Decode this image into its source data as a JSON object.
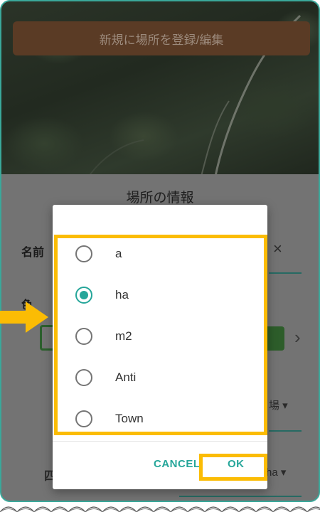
{
  "header": {
    "title": "新規に場所を登録/編集"
  },
  "sheet": {
    "title": "場所の情報",
    "name_label": "名前",
    "name_required_mark": "*",
    "clear_glyph": "×",
    "color_label": "色",
    "next_glyph": "›",
    "unit_value_1": "場 ▾",
    "unit_label_2": "四",
    "unit_value_2": "ha ▾"
  },
  "dialog": {
    "options": [
      {
        "label": "a",
        "selected": false
      },
      {
        "label": "ha",
        "selected": true
      },
      {
        "label": "m2",
        "selected": false
      },
      {
        "label": "Anti",
        "selected": false
      },
      {
        "label": "Town",
        "selected": false
      }
    ],
    "cancel_label": "CANCEL",
    "ok_label": "OK"
  },
  "colors": {
    "accent": "#26a69a",
    "highlight": "#fbbc04",
    "frame": "#3aa89a",
    "selected_swatch": "#2d5d2a"
  }
}
